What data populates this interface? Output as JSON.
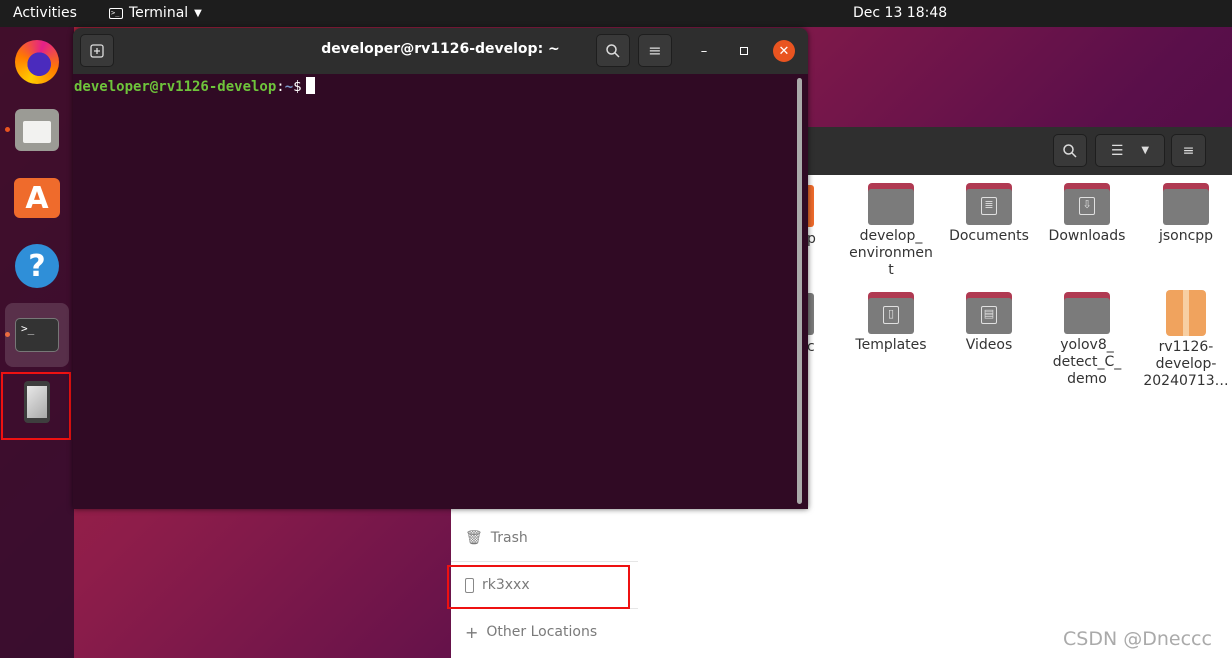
{
  "topbar": {
    "activities": "Activities",
    "app_menu": "Terminal",
    "clock": "Dec 13  18:48"
  },
  "dock": {
    "items": [
      {
        "name": "firefox"
      },
      {
        "name": "files"
      },
      {
        "name": "software"
      },
      {
        "name": "help"
      },
      {
        "name": "terminal"
      },
      {
        "name": "rk3xxx device"
      }
    ]
  },
  "terminal": {
    "title": "developer@rv1126-develop: ~",
    "prompt_user": "developer@rv1126-develop",
    "prompt_sep": ":",
    "prompt_path": "~",
    "prompt_end": "$"
  },
  "files": {
    "partial_labels": [
      "p",
      "c"
    ],
    "folders": [
      {
        "label": "develop_\nenvironmen\nt",
        "emblem": ""
      },
      {
        "label": "Documents",
        "emblem": "doc"
      },
      {
        "label": "Downloads",
        "emblem": "download"
      },
      {
        "label": "jsoncpp",
        "emblem": ""
      },
      {
        "label": "Templates",
        "emblem": "template"
      },
      {
        "label": "Videos",
        "emblem": "video"
      },
      {
        "label": "yolov8_\ndetect_C_\ndemo",
        "emblem": ""
      },
      {
        "label": "rv1126-\ndevelop-\n20240713…",
        "emblem": "package"
      }
    ],
    "sidebar": {
      "trash": "Trash",
      "device": "rk3xxx",
      "other": "Other Locations"
    }
  },
  "watermark": "CSDN @Dneccc"
}
